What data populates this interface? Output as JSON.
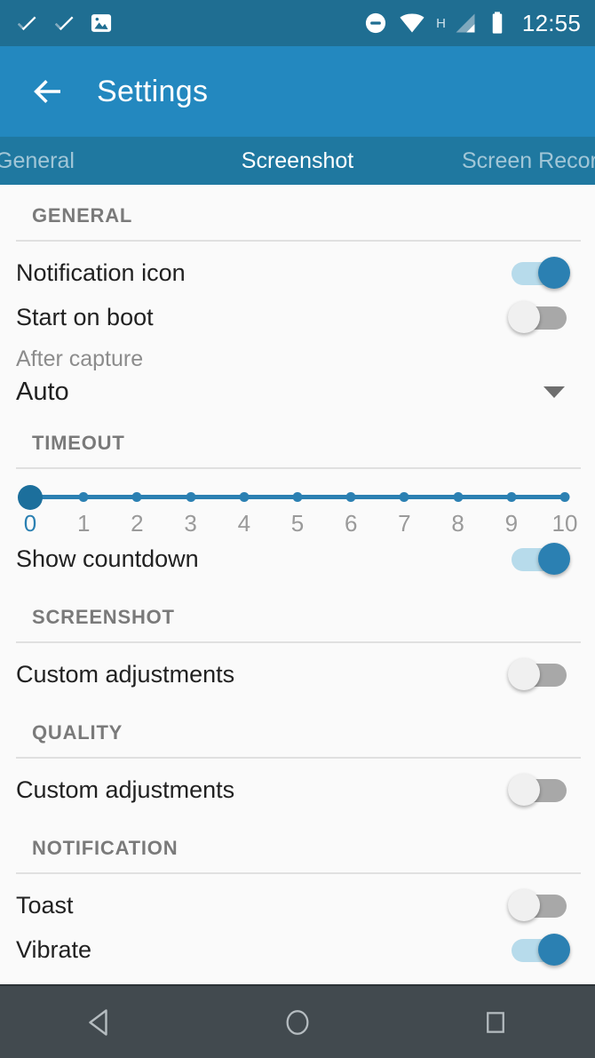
{
  "status_bar": {
    "time": "12:55",
    "icons_left": [
      "check-icon",
      "check-icon",
      "image-icon"
    ],
    "icons_right": [
      "do-not-disturb-icon",
      "wifi-icon",
      "hspa-signal-icon",
      "cellular-signal-icon",
      "battery-icon"
    ],
    "network_type": "H",
    "background": "#1f6e92"
  },
  "app_bar": {
    "title": "Settings",
    "back_icon": "arrow-left-icon",
    "background": "#2388bf"
  },
  "tabs": {
    "background": "#1f78a0",
    "items": [
      {
        "label": "General",
        "active": false
      },
      {
        "label": "Screenshot",
        "active": true
      },
      {
        "label": "Screen Recor",
        "active": false
      }
    ]
  },
  "sections": {
    "general": {
      "header": "GENERAL",
      "rows": [
        {
          "label": "Notification icon",
          "state": "on"
        },
        {
          "label": "Start on boot",
          "state": "off"
        }
      ],
      "dropdown": {
        "label": "After capture",
        "value": "Auto",
        "caret_icon": "chevron-down-icon"
      }
    },
    "timeout": {
      "header": "TIMEOUT",
      "slider": {
        "min": 0,
        "max": 10,
        "value": 0,
        "ticks": [
          "0",
          "1",
          "2",
          "3",
          "4",
          "5",
          "6",
          "7",
          "8",
          "9",
          "10"
        ],
        "accent": "#2b80b2"
      },
      "rows": [
        {
          "label": "Show countdown",
          "state": "on"
        }
      ]
    },
    "screenshot": {
      "header": "SCREENSHOT",
      "rows": [
        {
          "label": "Custom adjustments",
          "state": "off"
        }
      ]
    },
    "quality": {
      "header": "QUALITY",
      "rows": [
        {
          "label": "Custom adjustments",
          "state": "off"
        }
      ]
    },
    "notification": {
      "header": "NOTIFICATION",
      "rows": [
        {
          "label": "Toast",
          "state": "off"
        },
        {
          "label": "Vibrate",
          "state": "on"
        }
      ]
    }
  },
  "nav_bar": {
    "background": "#424a4f",
    "buttons": [
      {
        "name": "back-nav-button",
        "icon": "triangle-left-icon"
      },
      {
        "name": "home-nav-button",
        "icon": "circle-icon"
      },
      {
        "name": "recents-nav-button",
        "icon": "square-icon"
      }
    ]
  }
}
